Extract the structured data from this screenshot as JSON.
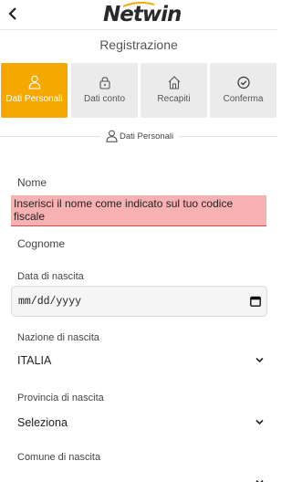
{
  "header": {
    "logo_text": "Netwin",
    "back_icon": "chevron-left-icon"
  },
  "page": {
    "title": "Registrazione"
  },
  "steps": [
    {
      "label": "Dati Personali",
      "icon": "person-icon",
      "active": true
    },
    {
      "label": "Dati conto",
      "icon": "lock-icon",
      "active": false
    },
    {
      "label": "Recapiti",
      "icon": "home-icon",
      "active": false
    },
    {
      "label": "Conferma",
      "icon": "check-circle-icon",
      "active": false
    }
  ],
  "section": {
    "label": "Dati Personali",
    "icon": "person-icon"
  },
  "form": {
    "nome_label": "Nome",
    "nome_error": "Inserisci il nome come indicato sul tuo codice fiscale",
    "cognome_label": "Cognome",
    "data_label": "Data di nascita",
    "data_placeholder": "mm/dd/yyyy",
    "nazione_label": "Nazione di nascita",
    "nazione_value": "ITALIA",
    "provincia_label": "Provincia di nascita",
    "provincia_value": "Seleziona",
    "comune_label": "Comune di nascita"
  },
  "colors": {
    "accent": "#f5a800",
    "error_bg": "#f7b1b3",
    "error_border": "#d9484f"
  }
}
